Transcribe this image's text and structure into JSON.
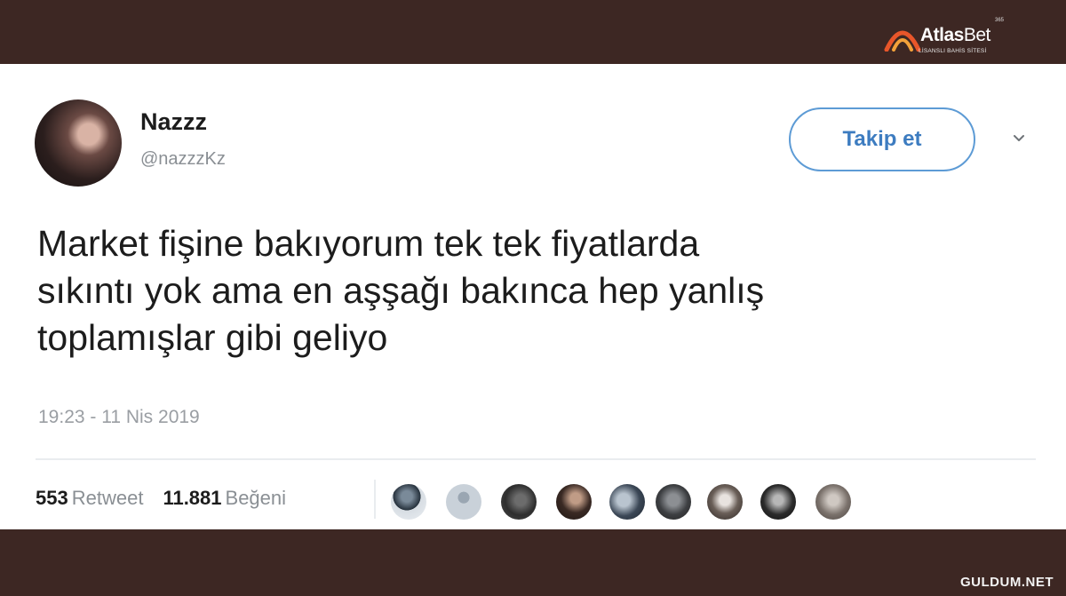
{
  "brand": {
    "name_bold": "Atlas",
    "name_light": "Bet",
    "superscript": "365",
    "tagline": "LİSANSLI BAHİS SİTESİ"
  },
  "tweet": {
    "display_name": "Nazzz",
    "handle": "@nazzzKz",
    "follow_label": "Takip et",
    "text_lines": [
      "Market fişine bakıyorum tek tek fiyatlarda",
      "sıkıntı yok ama en aşşağı bakınca hep yanlış",
      "toplamışlar gibi geliyo"
    ],
    "timestamp": "19:23 - 11 Nis 2019",
    "retweets": {
      "count": "553",
      "label": "Retweet"
    },
    "likes": {
      "count": "11.881",
      "label": "Beğeni"
    },
    "liker_avatar_count": 9
  },
  "watermark": "GULDUM.NET",
  "colors": {
    "frame": "#3d2723",
    "follow_blue": "#3d7cc0",
    "follow_border": "#5d9bd5",
    "muted_text": "#8a8f94"
  }
}
